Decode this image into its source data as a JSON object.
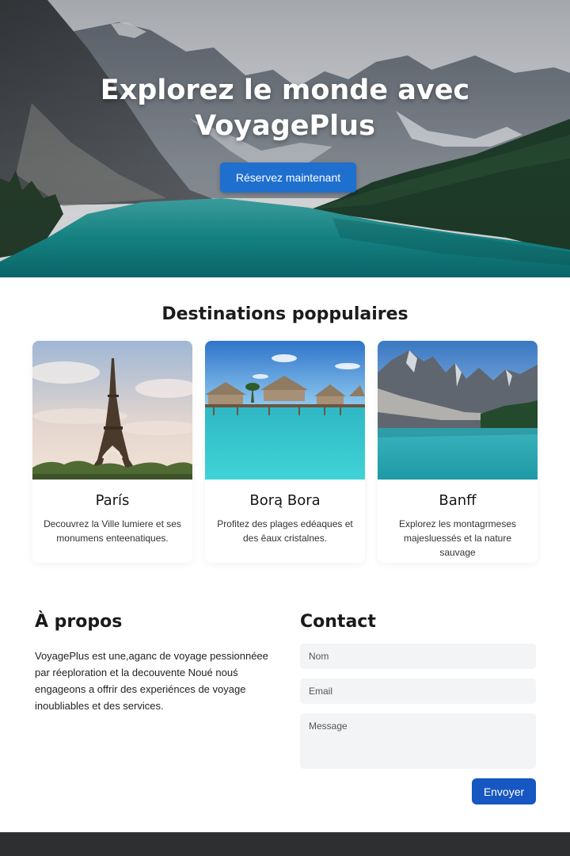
{
  "hero": {
    "title_line1": "Explorez le monde avec",
    "title_line2": "VoyagePlus",
    "cta_label": "Réservez maintenant"
  },
  "destinations": {
    "title": "Destinations poppulaires",
    "cards": [
      {
        "name": "París",
        "description": "Decouvrez la Ville lumiere et ses monumens enteenatiques.",
        "image": "eiffel-tower-photo"
      },
      {
        "name": "Borą Bora",
        "description": "Profitez des plages edéaques et des êaux cristalnes.",
        "image": "overwater-bungalows-photo"
      },
      {
        "name": "Banff",
        "description": "Explorez les montagrmeses majesluessés et la nature sauvage",
        "image": "mountain-lake-photo"
      }
    ]
  },
  "about": {
    "title": "À propos",
    "text": "VoyagePlus est une,aganc de voyage pessionnéee par réeploration et la decouvente Noué nouś engageons a offrir des experiénces de voyage inoubliables et des services."
  },
  "contact": {
    "title": "Contact",
    "name_placeholder": "Nom",
    "email_placeholder": "Email",
    "message_placeholder": "Message",
    "submit_label": "Envoyer"
  },
  "colors": {
    "primary_button": "#1f6fcf",
    "send_button": "#1657c2",
    "footer": "#2e2f31",
    "field_bg": "#f3f4f6"
  }
}
